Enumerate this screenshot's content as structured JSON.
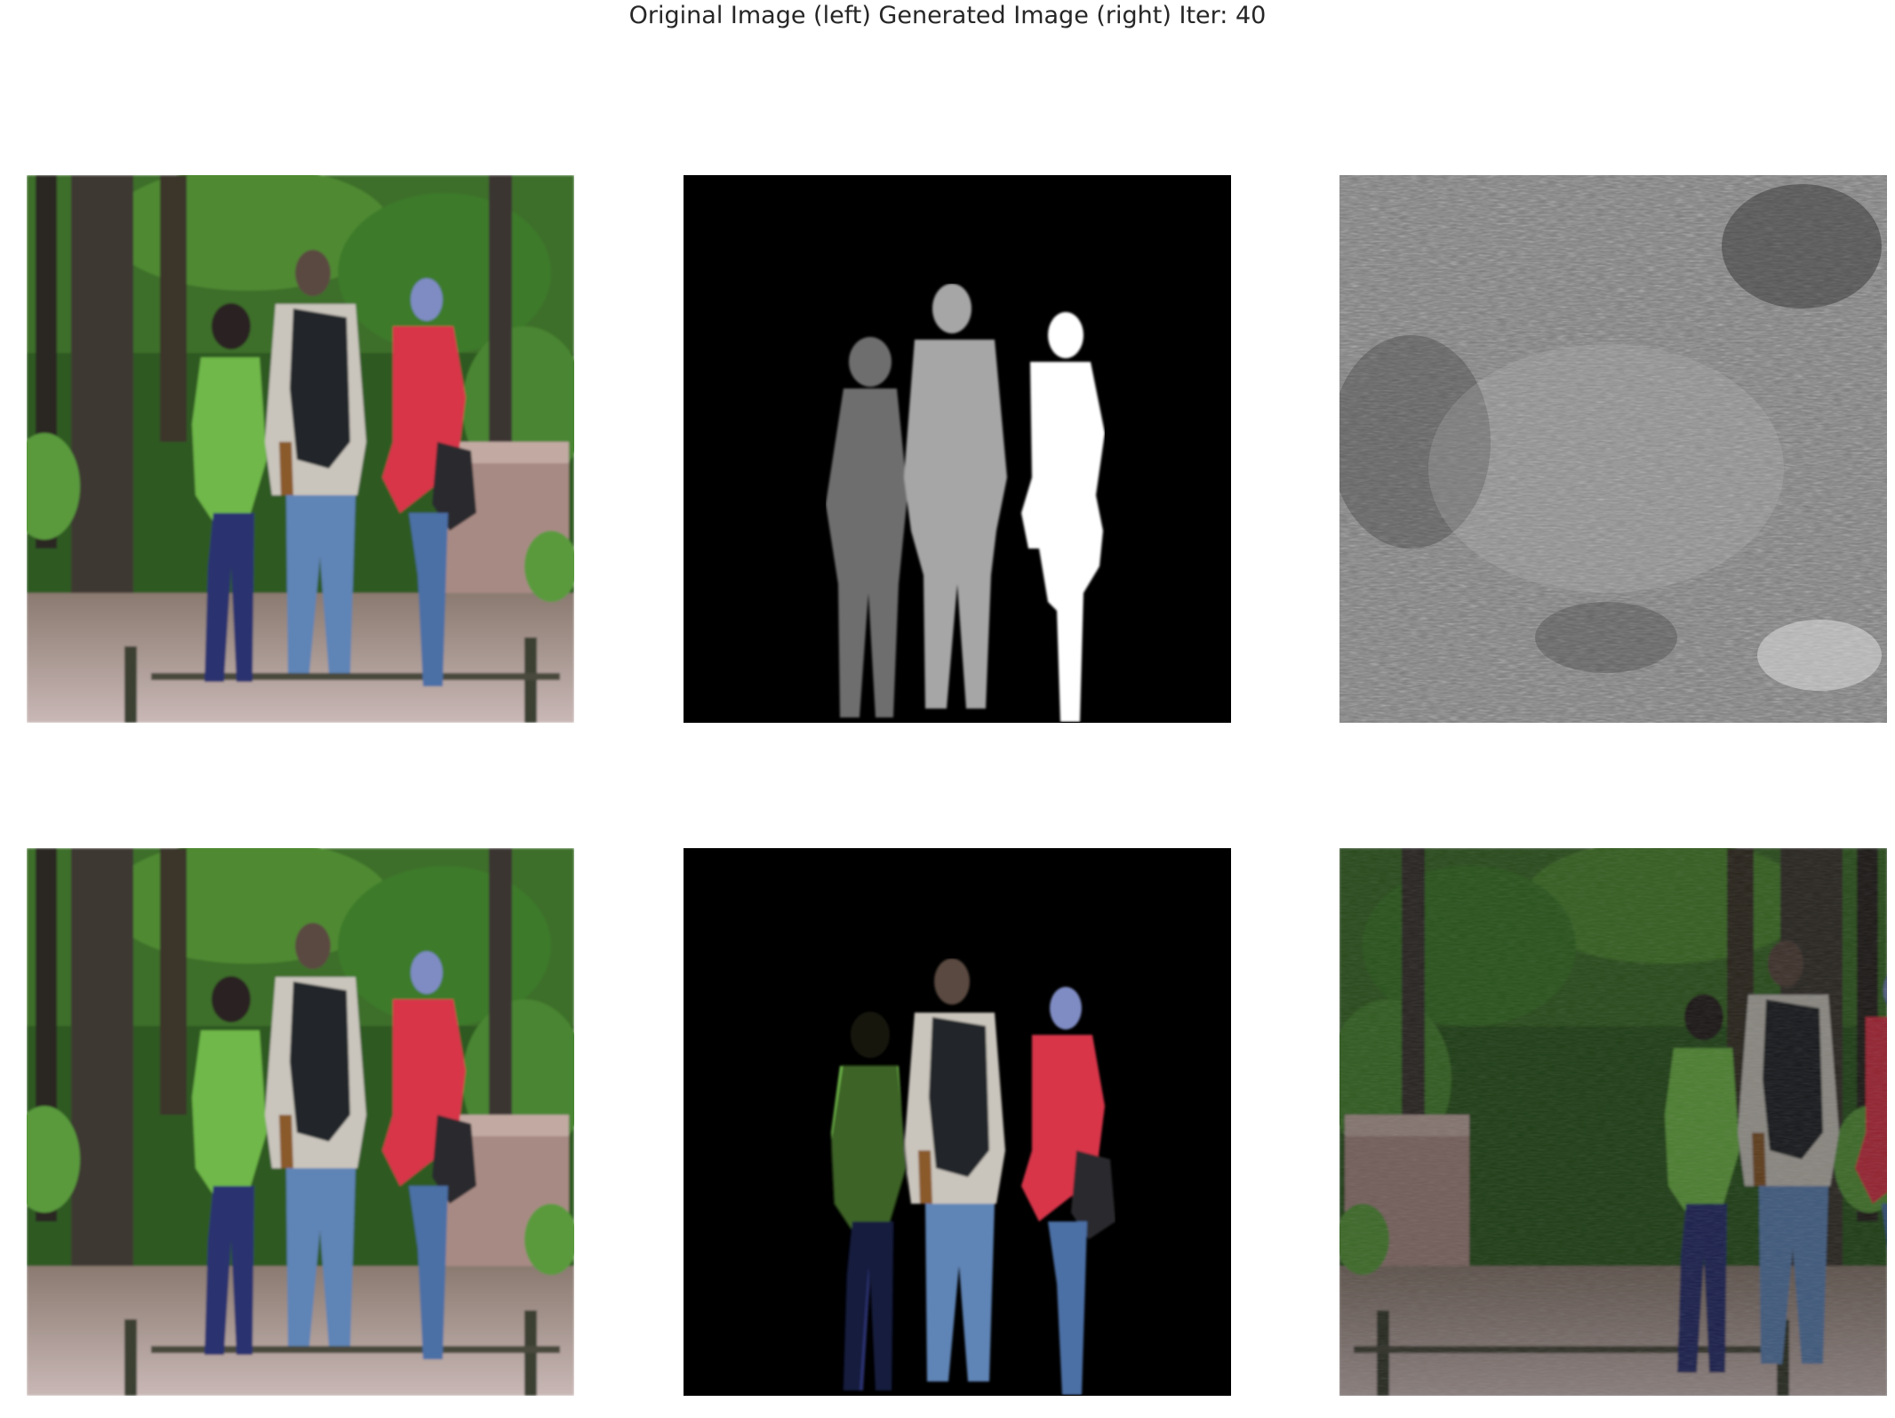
{
  "figure": {
    "title": "Original Image (left) Generated Image (right) Iter: 40"
  },
  "panels": [
    {
      "row": 1,
      "col": 1,
      "content": "original-photo"
    },
    {
      "row": 1,
      "col": 2,
      "content": "segmentation-mask"
    },
    {
      "row": 1,
      "col": 3,
      "content": "generated-grayscale-noise"
    },
    {
      "row": 2,
      "col": 1,
      "content": "original-photo"
    },
    {
      "row": 2,
      "col": 2,
      "content": "masked-people"
    },
    {
      "row": 2,
      "col": 3,
      "content": "generated-color"
    }
  ],
  "colors": {
    "background": "#ffffff",
    "title_text": "#262626",
    "foliage": "#2f5a22",
    "shirt_red": "#d8344a",
    "shirt_green": "#6fb84a",
    "jeans_blue": "#4a6f9a"
  }
}
